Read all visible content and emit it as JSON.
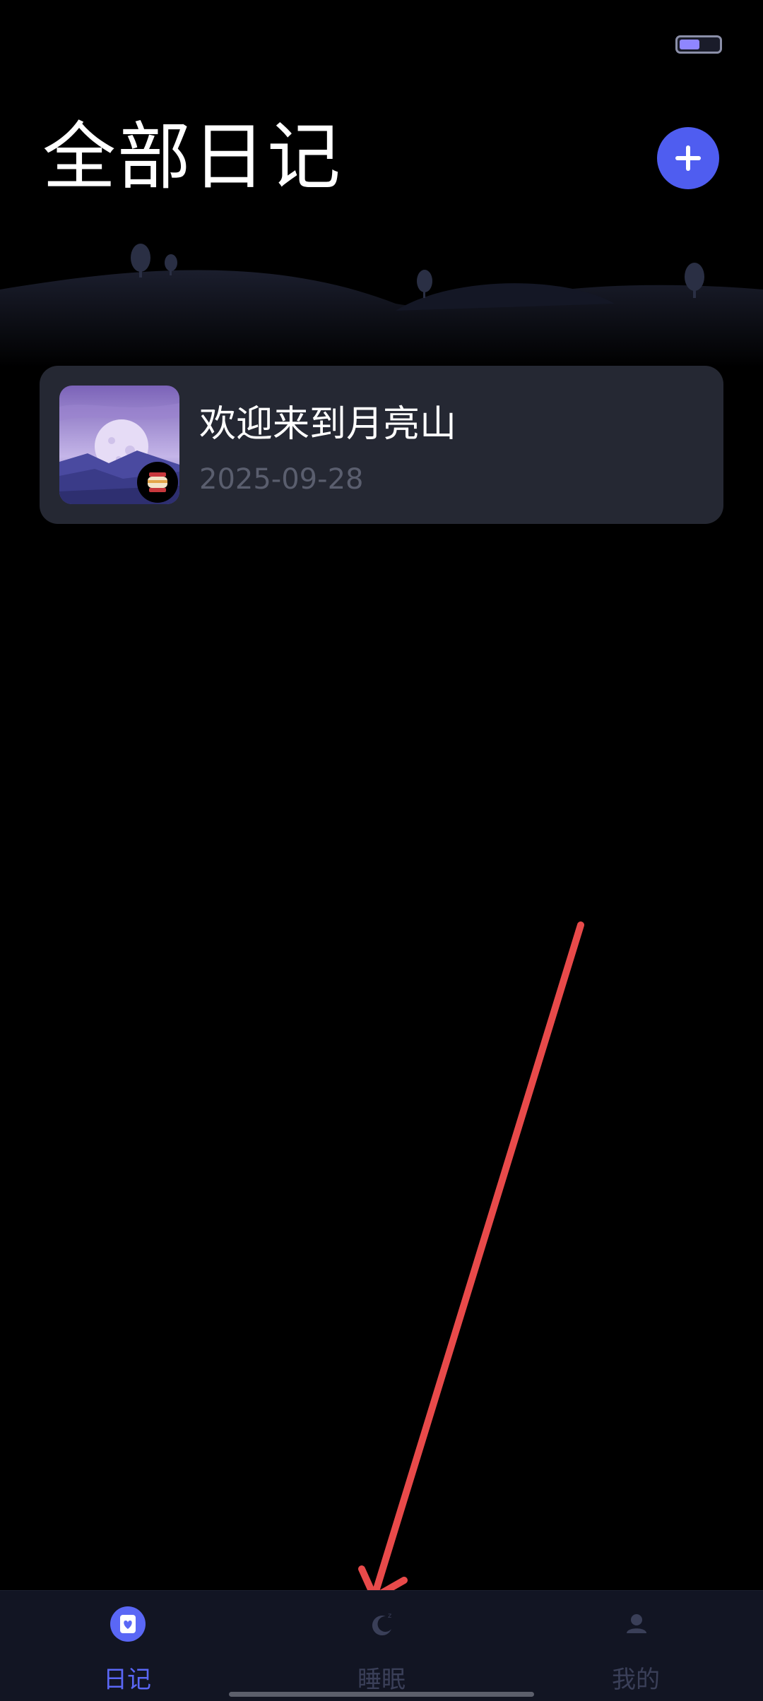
{
  "header": {
    "title": "全部日记"
  },
  "diary_list": [
    {
      "title": "欢迎来到月亮山",
      "date": "2025-09-28",
      "thumbnail_icon": "moon-mountain-thumbnail",
      "badge_icon": "lantern-icon"
    }
  ],
  "tab_bar": {
    "tabs": [
      {
        "label": "日记",
        "icon": "diary-heart-icon",
        "active": true
      },
      {
        "label": "睡眠",
        "icon": "moon-sleep-icon",
        "active": false
      },
      {
        "label": "我的",
        "icon": "person-icon",
        "active": false
      }
    ]
  },
  "colors": {
    "accent": "#4f5df0",
    "card_bg": "#252833",
    "tab_bar_bg": "#121523",
    "tab_active": "#5a67f5",
    "tab_inactive": "#3a3f58",
    "annotation_arrow": "#e84a4a"
  }
}
